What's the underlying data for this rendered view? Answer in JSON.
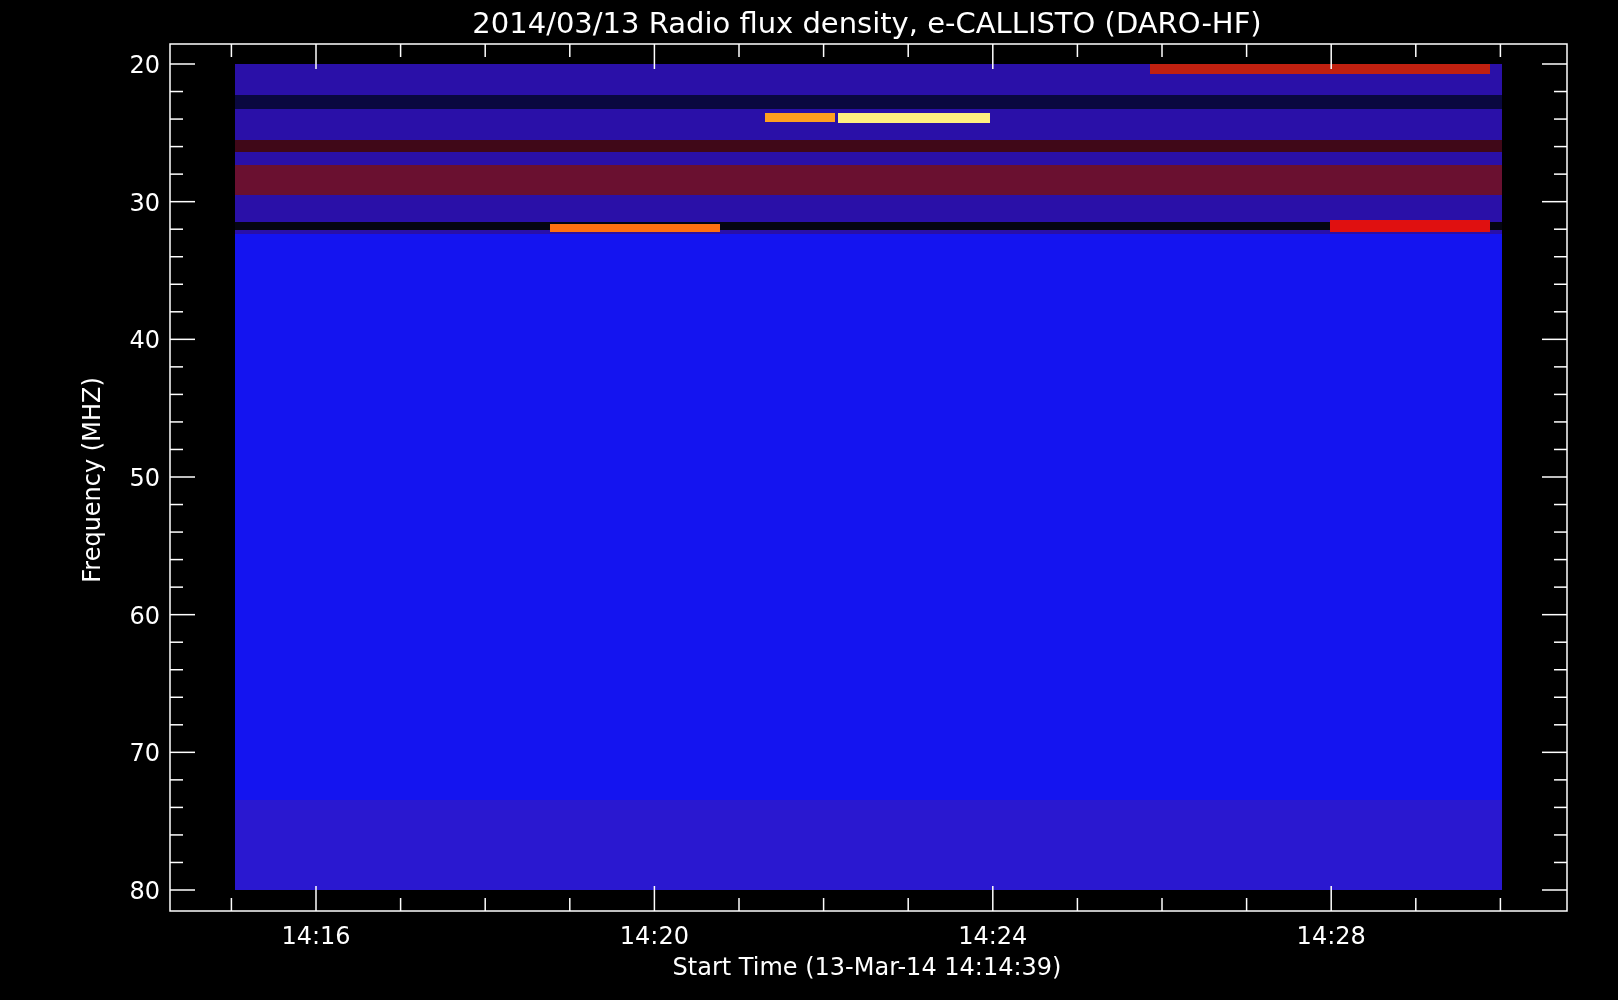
{
  "title": "2014/03/13  Radio flux density, e-CALLISTO (DARO-HF)",
  "y_axis": {
    "label": "Frequency (MHZ)",
    "ticks": [
      "20",
      "30",
      "40",
      "50",
      "60",
      "70",
      "80"
    ]
  },
  "x_axis": {
    "label": "Start Time (13-Mar-14 14:14:39)",
    "ticks": [
      "14:16",
      "14:20",
      "14:24",
      "14:28"
    ]
  }
}
